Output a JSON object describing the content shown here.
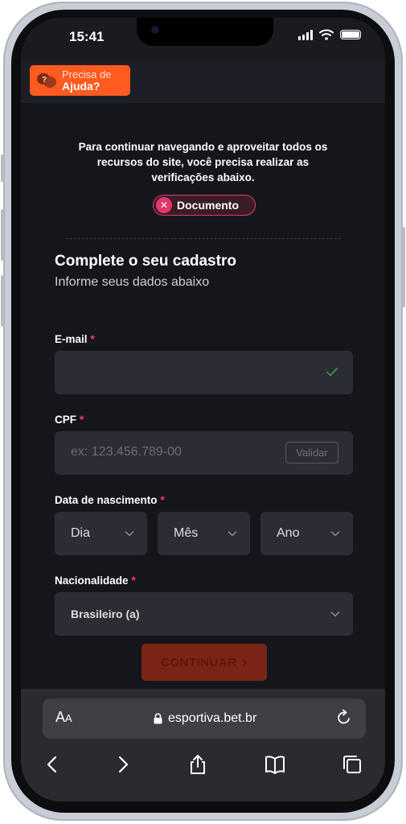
{
  "status_bar": {
    "time": "15:41"
  },
  "help_button": {
    "line1": "Precisa de",
    "line2": "Ajuda?"
  },
  "notice": {
    "text": "Para continuar navegando e aproveitar todos os recursos do site, você precisa realizar as verificações abaixo.",
    "document_pill": "Documento"
  },
  "form": {
    "title": "Complete o seu cadastro",
    "subtitle": "Informe seus dados abaixo",
    "email": {
      "label": "E-mail",
      "required_mark": "*",
      "value": "",
      "valid": true
    },
    "cpf": {
      "label": "CPF",
      "required_mark": "*",
      "placeholder": "ex: 123.456.789-00",
      "validate_label": "Validar"
    },
    "birthdate": {
      "label": "Data de nascimento",
      "required_mark": "*",
      "day": "Dia",
      "month": "Mês",
      "year": "Ano"
    },
    "nationality": {
      "label": "Nacionalidade",
      "required_mark": "*",
      "value": "Brasileiro (a)"
    },
    "continue_label": "CONTINUAR",
    "continue_arrow": "›"
  },
  "browser": {
    "aa_big": "A",
    "aa_small": "A",
    "url": "esportiva.bet.br"
  },
  "colors": {
    "accent": "#ff5a1f",
    "required": "#ff3b5c",
    "document_pill": "#e0386a",
    "background": "#15161c",
    "input": "#2c2d34"
  },
  "icons": [
    "chat-bubbles-icon",
    "close-icon",
    "check-icon",
    "chevron-down-icon",
    "chevron-right-icon",
    "lock-icon",
    "reload-icon",
    "back-icon",
    "forward-icon",
    "share-icon",
    "bookmarks-icon",
    "tabs-icon"
  ]
}
